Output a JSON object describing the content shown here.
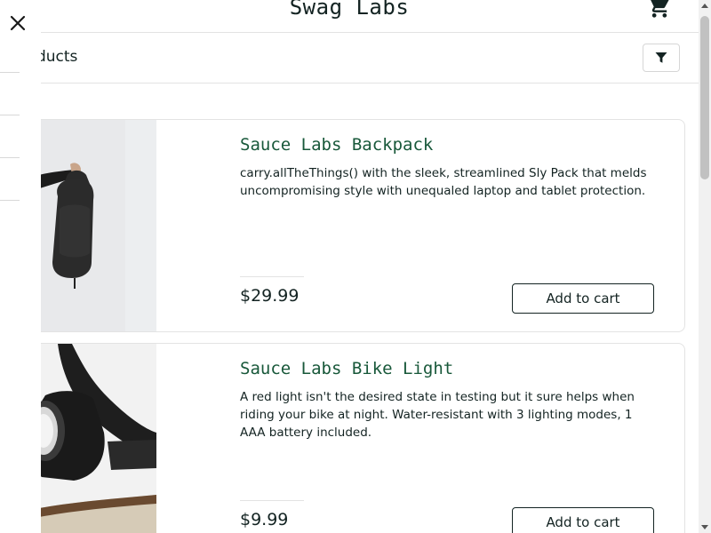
{
  "header": {
    "app_logo": "Swag Labs",
    "cart_icon": "cart-icon"
  },
  "secondary_header": {
    "title": "Products",
    "sort_icon": "filter-icon"
  },
  "menu": {
    "close_icon": "close-icon",
    "state": "open"
  },
  "inventory": {
    "items": [
      {
        "name": "Sauce Labs Backpack",
        "description": "carry.allTheThings() with the sleek, streamlined Sly Pack that melds uncompromising style with unequaled laptop and tablet protection.",
        "price": "$29.99",
        "button": "Add to cart",
        "image": "backpack-photo"
      },
      {
        "name": "Sauce Labs Bike Light",
        "description": "A red light isn't the desired state in testing but it sure helps when riding your bike at night. Water-resistant with 3 lighting modes, 1 AAA battery included.",
        "price": "$9.99",
        "button": "Add to cart",
        "image": "bike-light-photo"
      }
    ]
  },
  "colors": {
    "item_name": "#18583a",
    "text": "#132322",
    "border": "#e3e3e3"
  }
}
